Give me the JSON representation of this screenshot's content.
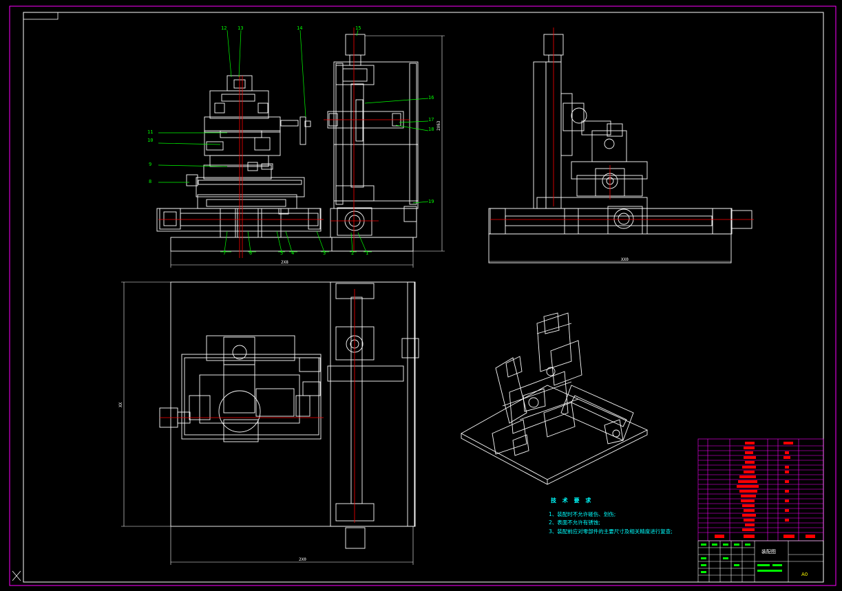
{
  "drawing": {
    "colors": {
      "background": "#000000",
      "sheet_border": "#ff00ff",
      "geometry": "#ffffff",
      "leader": "#00ff00",
      "centerline": "#ff0000",
      "notes": "#00ffff",
      "bom_fill": "#ff0000"
    },
    "balloons": {
      "b1": "12",
      "b2": "13",
      "b3": "14",
      "b4": "15",
      "b5": "16",
      "b6": "17",
      "b7": "18",
      "b8": "11",
      "b9": "10",
      "b10": "9",
      "b11": "8",
      "b12": "19",
      "b13": "7",
      "b14": "6",
      "b15": "5",
      "b16": "4",
      "b17": "3",
      "b18": "2",
      "b19": "1"
    },
    "dimensions": {
      "front_width": "2X8",
      "front_height": "2X63",
      "side_width": "XX0",
      "plan_width": "2X0",
      "plan_height": "XX"
    },
    "notes": {
      "title": "技 术 要 求",
      "lines": [
        "1、装配时不允许碰伤、划伤;",
        "2、表面不允许有锈蚀;",
        "3、装配前应对零部件的主要尺寸及相关精度进行复查;"
      ]
    },
    "title_block": {
      "name": "装配图",
      "sheet": "A0"
    }
  }
}
